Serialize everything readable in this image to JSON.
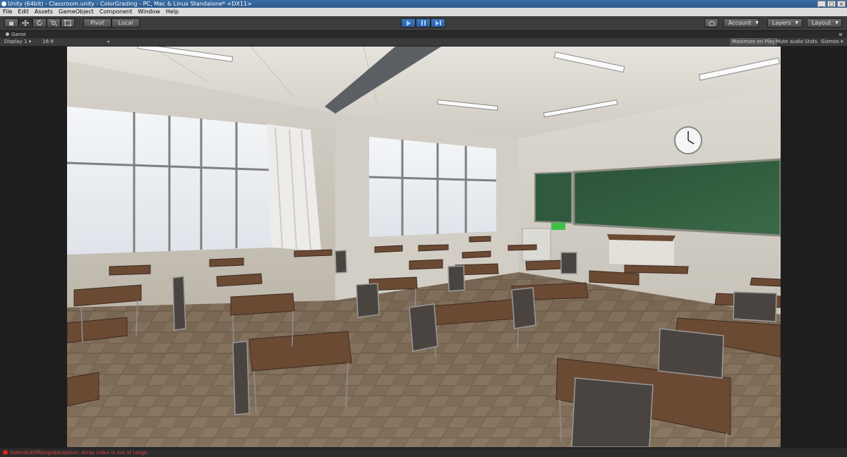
{
  "window": {
    "title": "Unity (64bit) - Classroom.unity - ColorGrading - PC, Mac & Linux Standalone* <DX11>"
  },
  "menu": [
    "File",
    "Edit",
    "Assets",
    "GameObject",
    "Component",
    "Window",
    "Help"
  ],
  "toolbar": {
    "pivot_label": "Pivot",
    "local_label": "Local",
    "account_label": "Account",
    "layers_label": "Layers",
    "layout_label": "Layout"
  },
  "game_tab": {
    "label": "Game"
  },
  "game_bar": {
    "display": "Display 1",
    "aspect": "16:9",
    "maximize_on_play": "Maximize on Play",
    "mute_audio": "Mute audio",
    "stats": "Stats",
    "gizmos": "Gizmos"
  },
  "status": {
    "message": "IndexOutOfRangeException: Array index is out of range."
  },
  "colors": {
    "accent": "#3f78c0",
    "error": "#e04545",
    "chalkboard": "#2e5a3c",
    "desk_top": "#6b4a34",
    "floor": "#8a7560"
  },
  "icons": [
    "hand-tool-icon",
    "move-tool-icon",
    "rotate-tool-icon",
    "scale-tool-icon",
    "rect-tool-icon",
    "play-icon",
    "pause-icon",
    "step-icon",
    "cloud-icon",
    "game-tab-icon",
    "error-icon"
  ]
}
